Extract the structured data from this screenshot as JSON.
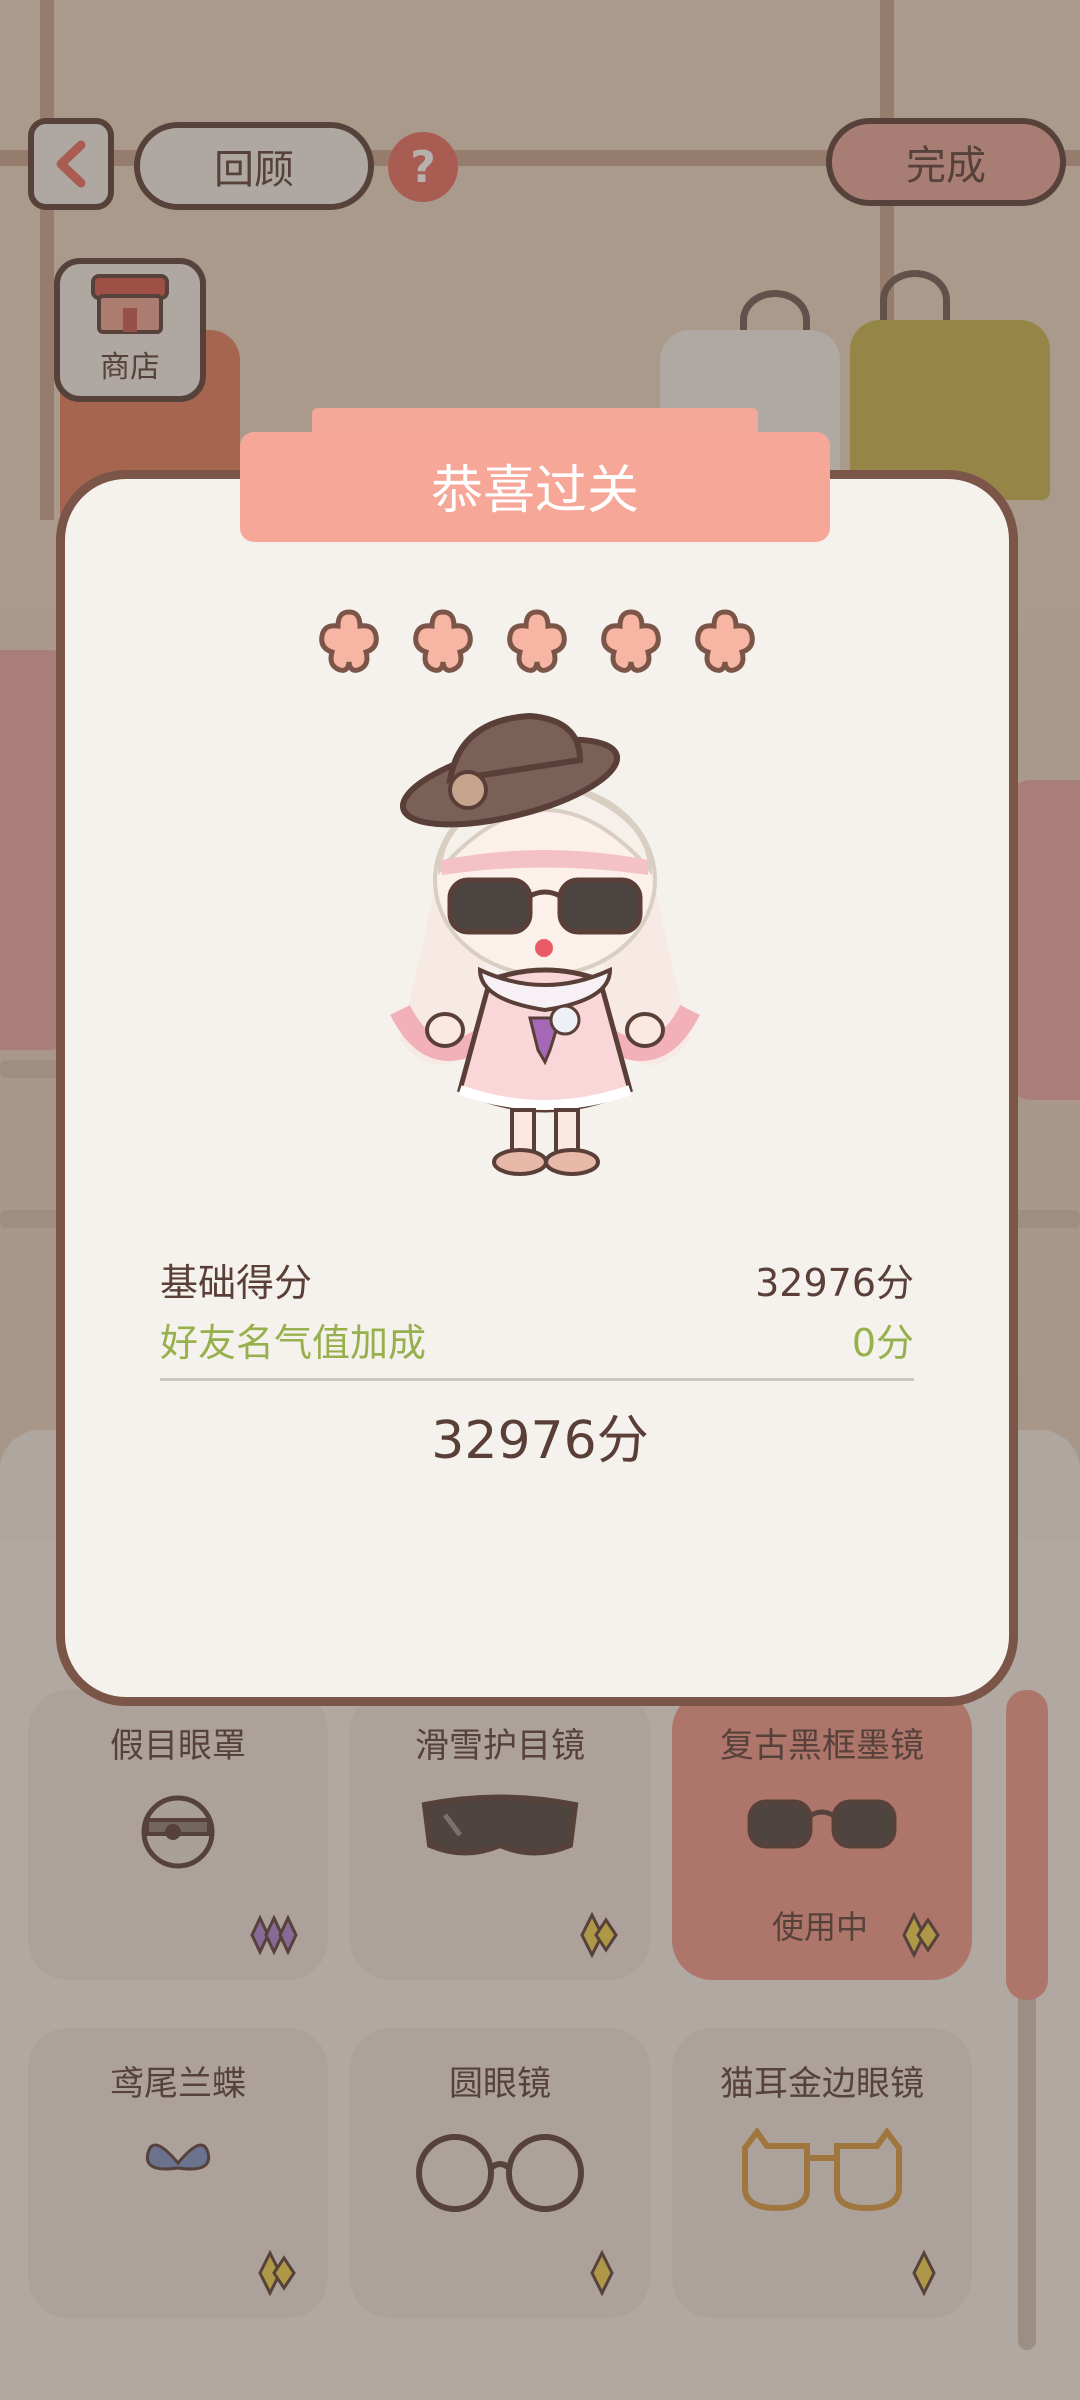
{
  "topbar": {
    "back_icon": "chevron-left-icon",
    "review_label": "回顾",
    "help_label": "?",
    "done_label": "完成",
    "shop_label": "商店"
  },
  "items": [
    {
      "name": "假目眼罩",
      "status": "",
      "rarity_color": "#b286d6"
    },
    {
      "name": "滑雪护目镜",
      "status": "",
      "rarity_color": "#f1d44e"
    },
    {
      "name": "复古黑框墨镜",
      "status": "使用中",
      "rarity_color": "#f1d44e"
    },
    {
      "name": "鸢尾兰蝶",
      "status": "",
      "rarity_color": "#f1d44e"
    },
    {
      "name": "圆眼镜",
      "status": "",
      "rarity_color": "#f1d44e"
    },
    {
      "name": "猫耳金边眼镜",
      "status": "",
      "rarity_color": "#f1d44e"
    }
  ],
  "dialog": {
    "title": "恭喜过关",
    "star_count": 5,
    "base_score_label": "基础得分",
    "base_score_value": "32976分",
    "friend_bonus_label": "好友名气值加成",
    "friend_bonus_value": "0分",
    "total_score": "32976分"
  },
  "colors": {
    "accent": "#f7a798",
    "border": "#7b5548",
    "bonus_green": "#97b04e",
    "help_red": "#e96d5e"
  }
}
